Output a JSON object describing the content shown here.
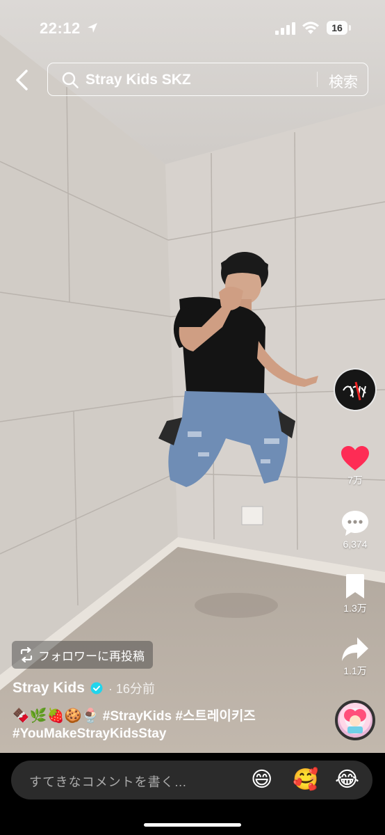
{
  "status_bar": {
    "time": "22:12",
    "battery": "16"
  },
  "search": {
    "query": "Stray Kids SKZ",
    "submit_label": "検索"
  },
  "actions": {
    "likes": "7万",
    "comments": "6,374",
    "saves": "1.3万",
    "shares": "1.1万",
    "like_color": "#fe2c55"
  },
  "post": {
    "repost_label": "フォロワーに再投稿",
    "author": "Stray Kids",
    "time_ago": "· 16分前",
    "caption_emojis": "🍫🌿🍓🍪🍨",
    "caption_tags_1": "#StrayKids #스트레이키즈",
    "caption_tags_2": "#YouMakeStrayKidsStay"
  },
  "comment_bar": {
    "placeholder": "すてきなコメントを書く…",
    "quick_emojis": [
      "😄",
      "🥰",
      "😂"
    ]
  }
}
